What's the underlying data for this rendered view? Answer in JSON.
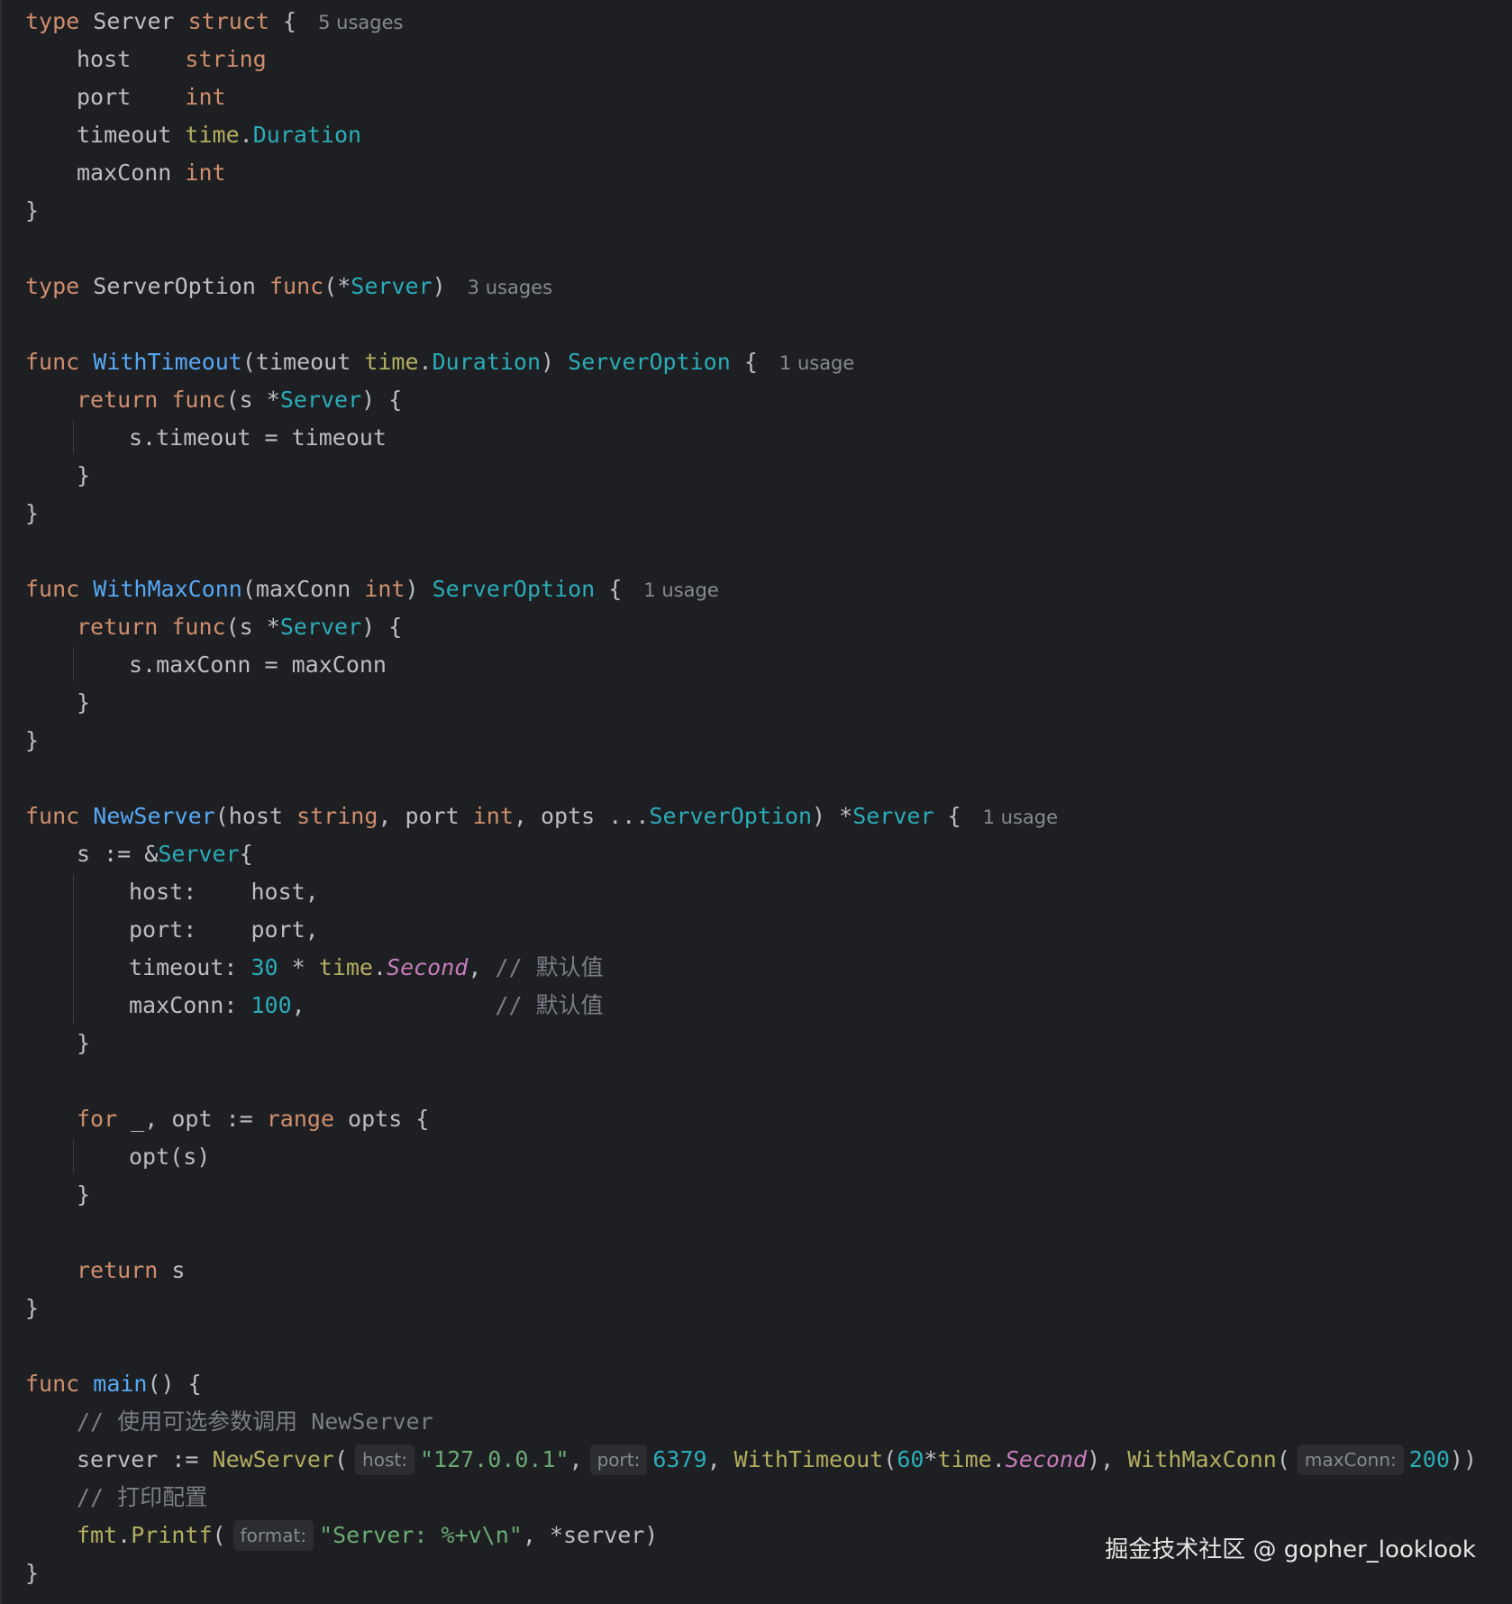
{
  "code": {
    "server_struct": {
      "kw_type": "type",
      "name": "Server",
      "kw_struct": "struct",
      "brace": "{",
      "usages": "5 usages",
      "fields": [
        {
          "name": "host   ",
          "type": "string"
        },
        {
          "name": "port   ",
          "type": "int"
        },
        {
          "name": "timeout",
          "pkg": "time",
          "dot": ".",
          "type": "Duration"
        },
        {
          "name": "maxConn",
          "type": "int"
        }
      ],
      "close": "}"
    },
    "server_option": {
      "kw_type": "type",
      "name": "ServerOption",
      "kw_func": "func",
      "open": "(*",
      "type": "Server",
      "close": ")",
      "usages": "3 usages"
    },
    "with_timeout": {
      "kw_func": "func",
      "name": "WithTimeout",
      "params_open": "(timeout ",
      "pkg": "time",
      "dot": ".",
      "ptype": "Duration",
      "params_close": ")",
      "ret": "ServerOption",
      "brace": "{",
      "usages": "1 usage",
      "kw_return": "return",
      "inner_func": "func",
      "inner_open": "(s *",
      "inner_type": "Server",
      "inner_close": ") {",
      "body": "s.timeout = timeout",
      "close_inner": "}",
      "close": "}"
    },
    "with_maxconn": {
      "kw_func": "func",
      "name": "WithMaxConn",
      "params_open": "(maxConn ",
      "ptype": "int",
      "params_close": ")",
      "ret": "ServerOption",
      "brace": "{",
      "usages": "1 usage",
      "kw_return": "return",
      "inner_func": "func",
      "inner_open": "(s *",
      "inner_type": "Server",
      "inner_close": ") {",
      "body": "s.maxConn = maxConn",
      "close_inner": "}",
      "close": "}"
    },
    "new_server": {
      "kw_func": "func",
      "name": "NewServer",
      "p1": "(host ",
      "t1": "string",
      "p2": ", port ",
      "t2": "int",
      "p3": ", opts ...",
      "t3": "ServerOption",
      "p4": ") *",
      "ret": "Server",
      "brace": " {",
      "usages": "1 usage",
      "s_assign": "s := &",
      "s_type": "Server",
      "s_open": "{",
      "f_host_key": "host:    ",
      "f_host_val": "host,",
      "f_port_key": "port:    ",
      "f_port_val": "port,",
      "f_timeout_key": "timeout: ",
      "f_timeout_num": "30",
      "f_timeout_op": " * ",
      "f_timeout_pkg": "time",
      "f_timeout_dot": ".",
      "f_timeout_const": "Second",
      "f_timeout_comma": ", ",
      "f_timeout_comment": "// 默认值",
      "f_maxconn_key": "maxConn: ",
      "f_maxconn_num": "100",
      "f_maxconn_comma": ",              ",
      "f_maxconn_comment": "// 默认值",
      "s_close": "}",
      "kw_for": "for",
      "for_mid": " _, opt := ",
      "kw_range": "range",
      "for_end": " opts {",
      "loop_body": "opt(s)",
      "loop_close": "}",
      "kw_return": "return",
      "ret_val": " s",
      "close": "}"
    },
    "main_func": {
      "kw_func": "func",
      "name": "main",
      "sig": "() {",
      "comment1": "// 使用可选参数调用 NewServer",
      "assign": "server := ",
      "call_new": "NewServer",
      "open": "(",
      "hint_host": "host:",
      "host_val": "\"127.0.0.1\"",
      "comma1": ",",
      "hint_port": "port:",
      "port_val": "6379",
      "comma2": ", ",
      "call_wt": "WithTimeout",
      "wt_open": "(",
      "wt_num": "60",
      "wt_op": "*",
      "wt_pkg": "time",
      "wt_dot": ".",
      "wt_const": "Second",
      "wt_close": "), ",
      "call_wm": "WithMaxConn",
      "wm_open": "(",
      "hint_maxconn": "maxConn:",
      "wm_num": "200",
      "wm_close": "))",
      "comment2": "// 打印配置",
      "pkg_fmt": "fmt",
      "fmt_dot": ".",
      "call_printf": "Printf",
      "printf_open": "(",
      "hint_format": "format:",
      "format_str": "\"Server: %+v\\n\"",
      "printf_rest": ", *server)",
      "close": "}"
    }
  },
  "watermark": "掘金技术社区 @ gopher_looklook"
}
